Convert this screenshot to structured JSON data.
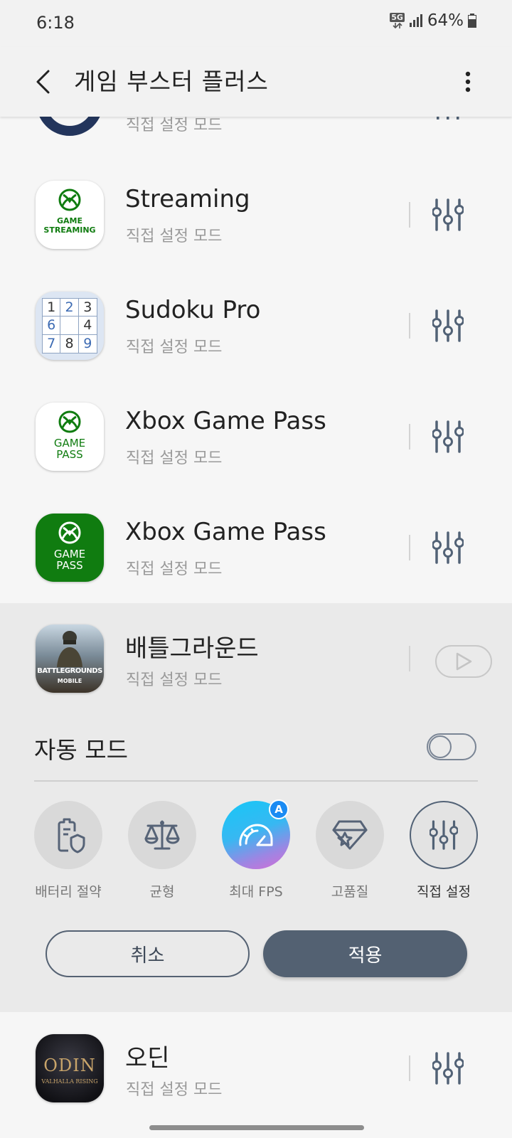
{
  "status_bar": {
    "time": "6:18",
    "network": "5G",
    "battery": "64%"
  },
  "app_bar": {
    "title": "게임 부스터 플러스"
  },
  "games": [
    {
      "name": "",
      "mode": "직접 설정 모드"
    },
    {
      "name": "Streaming",
      "mode": "직접 설정 모드",
      "icon_text": [
        "GAME",
        "STREAMING"
      ]
    },
    {
      "name": "Sudoku Pro",
      "mode": "직접 설정 모드",
      "icon_digits": [
        "1",
        "2",
        "3",
        "6",
        "",
        "4",
        "7",
        "8",
        "9"
      ]
    },
    {
      "name": "Xbox Game Pass",
      "mode": "직접 설정 모드",
      "icon_text": [
        "GAME",
        "PASS"
      ]
    },
    {
      "name": "Xbox Game Pass",
      "mode": "직접 설정 모드",
      "icon_text": [
        "GAME",
        "PASS"
      ]
    },
    {
      "name": "배틀그라운드",
      "mode": "직접 설정 모드",
      "icon_text": [
        "BATTLEGROUNDS",
        "MOBILE"
      ]
    },
    {
      "name": "오딘",
      "mode": "직접 설정 모드",
      "icon_text": [
        "ODIN",
        "VALHALLA RISING"
      ]
    }
  ],
  "expanded": {
    "auto_mode_label": "자동 모드",
    "auto_mode_on": false,
    "modes": [
      {
        "label": "배터리 절약",
        "icon": "battery-shield-icon"
      },
      {
        "label": "균형",
        "icon": "scale-icon"
      },
      {
        "label": "최대 FPS",
        "icon": "speedometer-icon",
        "badge": "A"
      },
      {
        "label": "고품질",
        "icon": "diamond-icon"
      },
      {
        "label": "직접 설정",
        "icon": "sliders-icon",
        "selected": true
      }
    ],
    "cancel_label": "취소",
    "apply_label": "적용"
  },
  "colors": {
    "xbox_green": "#107c10",
    "apply_button": "#536172",
    "fps_gradient": [
      "#1ec8f5",
      "#c86ad8"
    ]
  }
}
